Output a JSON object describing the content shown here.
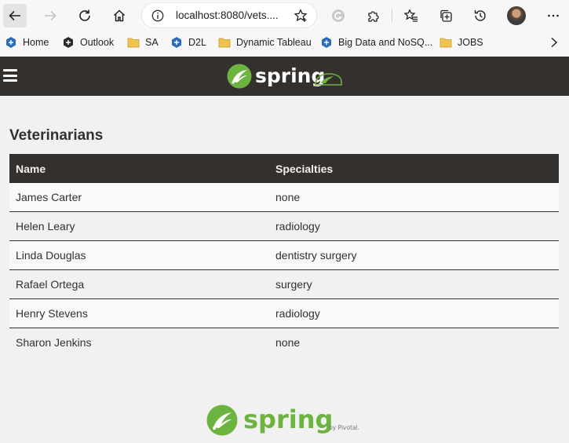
{
  "browser": {
    "url": "localhost:8080/vets....",
    "icons": [
      "back-arrow-icon",
      "forward-arrow-icon",
      "refresh-icon",
      "home-icon",
      "info-icon",
      "add-favorite-icon",
      "grammarly-icon",
      "extensions-icon",
      "favorites-icon",
      "collections-icon",
      "history-icon",
      "profile-avatar",
      "more-icon"
    ]
  },
  "bookmarks": [
    {
      "label": "Home",
      "icon": "bookmark-site-icon"
    },
    {
      "label": "Outlook",
      "icon": "bookmark-site-icon"
    },
    {
      "label": "SA",
      "icon": "folder-icon"
    },
    {
      "label": "D2L",
      "icon": "bookmark-site-icon"
    },
    {
      "label": "Dynamic Tableau",
      "icon": "folder-icon"
    },
    {
      "label": "Big Data and NoSQ...",
      "icon": "bookmark-site-icon"
    },
    {
      "label": "JOBS",
      "icon": "folder-icon"
    }
  ],
  "navbar": {
    "brand": "spring",
    "colors": {
      "background": "#34302d",
      "accent": "#6db33f"
    }
  },
  "page": {
    "heading": "Veterinarians"
  },
  "vets_table": {
    "headers": [
      "Name",
      "Specialties"
    ],
    "rows": [
      {
        "name": "James Carter",
        "specialties": "none"
      },
      {
        "name": "Helen Leary",
        "specialties": "radiology"
      },
      {
        "name": "Linda Douglas",
        "specialties": "dentistry surgery"
      },
      {
        "name": "Rafael Ortega",
        "specialties": "surgery"
      },
      {
        "name": "Henry Stevens",
        "specialties": "radiology"
      },
      {
        "name": "Sharon Jenkins",
        "specialties": "none"
      }
    ]
  },
  "footer": {
    "brand": "spring",
    "by_text": "by Pivotal."
  }
}
